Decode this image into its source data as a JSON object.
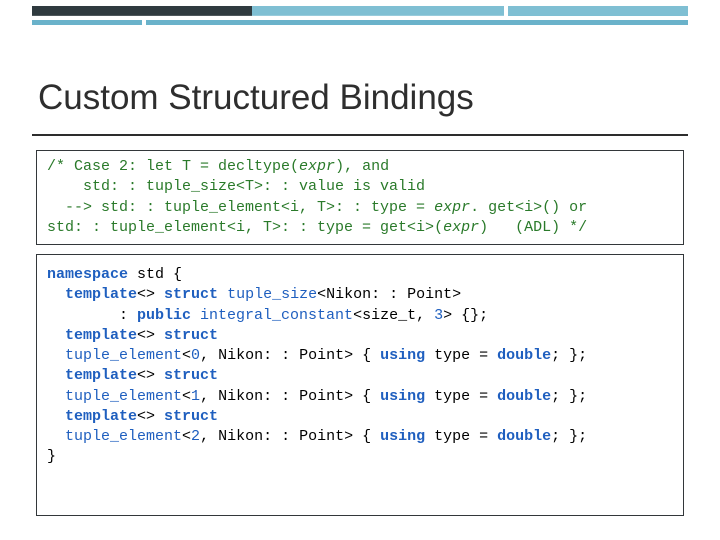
{
  "title": "Custom Structured Bindings",
  "comment": {
    "l1_a": "/* Case 2: let T = decltype(",
    "l1_b": "expr",
    "l1_c": "), and",
    "l2": "    std: : tuple_size<T>: : value is valid",
    "l3_a": "  --> std: : tuple_element<i, T>: : type = ",
    "l3_b": "expr",
    "l3_c": ". get<i>() or",
    "l4_a": "std: : tuple_element<i, T>: : type = get<i>(",
    "l4_b": "expr",
    "l4_c": ")   (ADL) */"
  },
  "code": {
    "l1_a": "namespace",
    "l1_b": " std {",
    "l2_a": "  ",
    "l2_b": "template",
    "l2_c": "<> ",
    "l2_d": "struct",
    "l2_e": " tuple_size",
    "l2_f": "<Nikon: : Point>",
    "l3_a": "        : ",
    "l3_b": "public",
    "l3_c": " integral_constant",
    "l3_d": "<size_t, ",
    "l3_e": "3",
    "l3_f": "> {};",
    "l4_a": "  ",
    "l4_b": "template",
    "l4_c": "<> ",
    "l4_d": "struct",
    "l5_a": "  tuple_element",
    "l5_b": "<",
    "l5_c": "0",
    "l5_d": ", Nikon: : Point> { ",
    "l5_e": "using",
    "l5_f": " type = ",
    "l5_g": "double",
    "l5_h": "; };",
    "l6_a": "  ",
    "l6_b": "template",
    "l6_c": "<> ",
    "l6_d": "struct",
    "l7_a": "  tuple_element",
    "l7_b": "<",
    "l7_c": "1",
    "l7_d": ", Nikon: : Point> { ",
    "l7_e": "using",
    "l7_f": " type = ",
    "l7_g": "double",
    "l7_h": "; };",
    "l8_a": "  ",
    "l8_b": "template",
    "l8_c": "<> ",
    "l8_d": "struct",
    "l9_a": "  tuple_element",
    "l9_b": "<",
    "l9_c": "2",
    "l9_d": ", Nikon: : Point> { ",
    "l9_e": "using",
    "l9_f": " type = ",
    "l9_g": "double",
    "l9_h": "; };",
    "l10": "}"
  }
}
